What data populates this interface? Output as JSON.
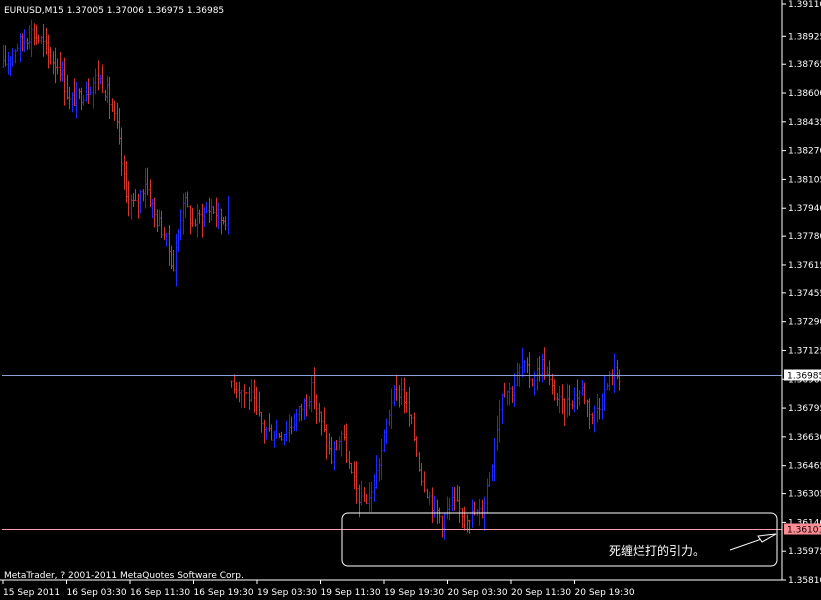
{
  "header": {
    "title": "EURUSD,M15  1.37005 1.37006 1.36975 1.36985"
  },
  "footer": {
    "copyright": "MetaTrader, ? 2001-2011 MetaQuotes Software Corp."
  },
  "annotation": {
    "text": "死缠烂打的引力。"
  },
  "price_marks": {
    "current": "1.36985",
    "support": "1.36101"
  },
  "colors": {
    "background": "#000000",
    "bull": "#1b2bff",
    "bear": "#d2362a",
    "current_line": "#8aa0d6",
    "support_line": "#ff9aa6",
    "support_label_bg": "#ff8c94"
  },
  "chart_data": {
    "type": "bar",
    "title": "EURUSD,M15",
    "ohlc_header": {
      "open": 1.37005,
      "high": 1.37006,
      "low": 1.36975,
      "close": 1.36985
    },
    "y_ticks": [
      "1.39110",
      "1.38925",
      "1.38765",
      "1.38600",
      "1.38435",
      "1.38270",
      "1.38105",
      "1.37940",
      "1.37780",
      "1.37615",
      "1.37455",
      "1.37290",
      "1.37125",
      "1.36960",
      "1.36795",
      "1.36630",
      "1.36465",
      "1.36305",
      "1.36140",
      "1.35975",
      "1.35810"
    ],
    "x_ticks": [
      "15 Sep 2011",
      "16 Sep 03:30",
      "16 Sep 11:30",
      "16 Sep 19:30",
      "19 Sep 03:30",
      "19 Sep 11:30",
      "19 Sep 19:30",
      "20 Sep 03:30",
      "20 Sep 11:30",
      "20 Sep 19:30"
    ],
    "ylim": [
      1.3581,
      1.3911
    ],
    "current_price": 1.36985,
    "support_price": 1.36101,
    "segment1_anchor": [
      1.3875,
      1.3885,
      1.389,
      1.3895,
      1.389,
      1.388,
      1.3875,
      1.3855,
      1.3858,
      1.3863,
      1.387,
      1.386,
      1.384,
      1.38,
      1.3795,
      1.381,
      1.379,
      1.378,
      1.376,
      1.38,
      1.3785,
      1.379,
      1.3795,
      1.3788,
      1.379
    ],
    "segment2_anchor": [
      1.3695,
      1.369,
      1.3685,
      1.367,
      1.3665,
      1.3665,
      1.367,
      1.368,
      1.369,
      1.367,
      1.365,
      1.3665,
      1.364,
      1.3625,
      1.363,
      1.3655,
      1.3685,
      1.369,
      1.367,
      1.364,
      1.3625,
      1.3615,
      1.3625,
      1.362,
      1.3618,
      1.362,
      1.365,
      1.369,
      1.369,
      1.3705,
      1.3695,
      1.3705,
      1.369,
      1.368,
      1.3685,
      1.369,
      1.3675,
      1.3685,
      1.37,
      1.3698
    ]
  }
}
